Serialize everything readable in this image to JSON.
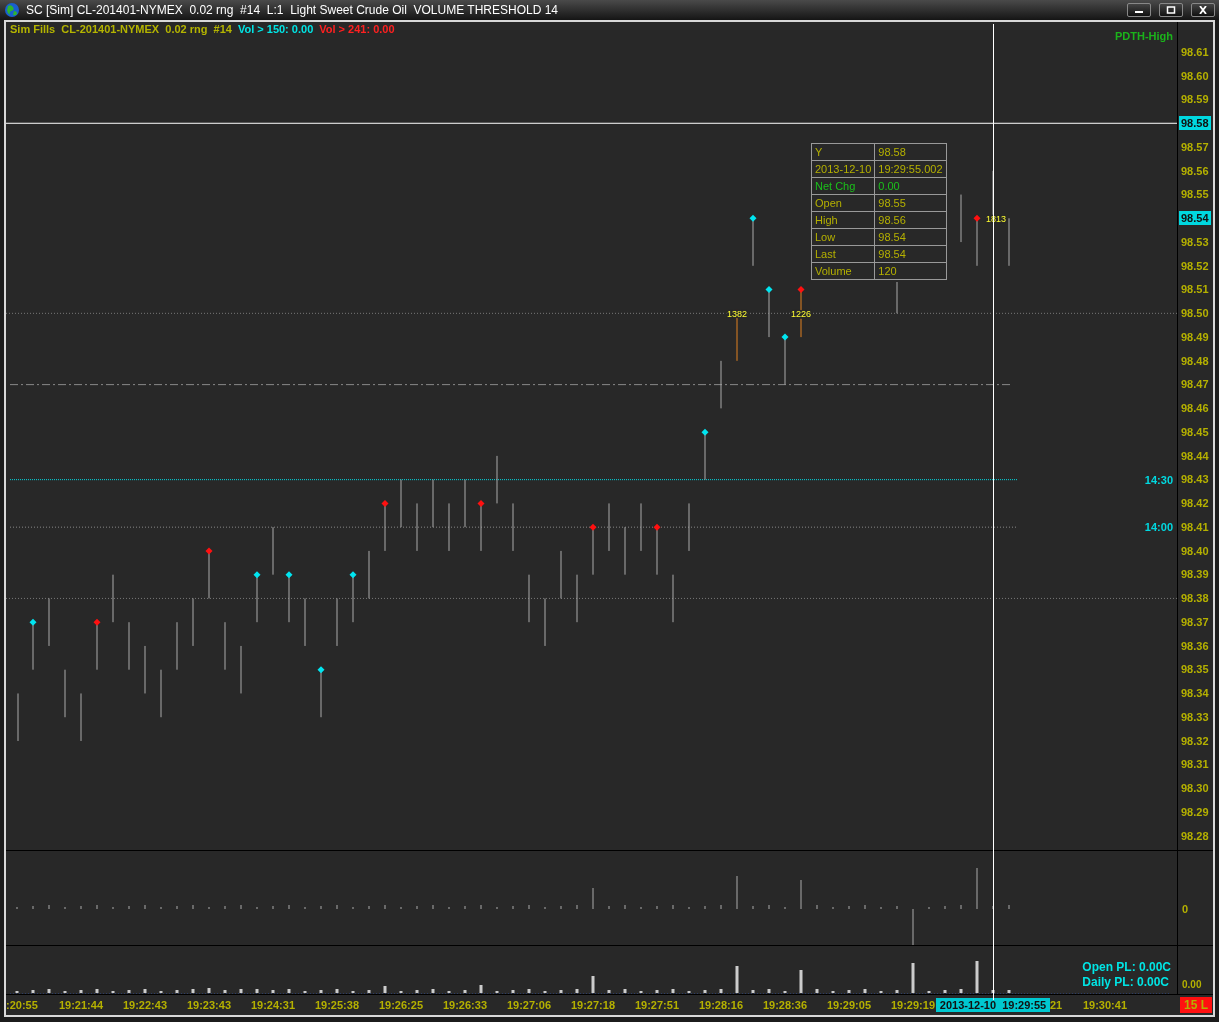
{
  "window": {
    "title": "SC [Sim] CL-201401-NYMEX  0.02 rng  #14  L:1  Light Sweet Crude Oil  VOLUME THRESHOLD 14"
  },
  "chart_header": [
    {
      "text": "Sim Fills  CL-201401-NYMEX  0.02 rng  #14",
      "color": "#b4b400"
    },
    {
      "text": "Vol > 150: 0.00",
      "color": "#00e5e5"
    },
    {
      "text": "Vol > 241: 0.00",
      "color": "#ff2020"
    }
  ],
  "study_label": "PDTH-High",
  "price_axis": [
    {
      "label": "98.61",
      "highlight": false
    },
    {
      "label": "98.60",
      "highlight": false
    },
    {
      "label": "98.59",
      "highlight": false
    },
    {
      "label": "98.58",
      "highlight": true
    },
    {
      "label": "98.57",
      "highlight": false
    },
    {
      "label": "98.56",
      "highlight": false
    },
    {
      "label": "98.55",
      "highlight": false
    },
    {
      "label": "98.54",
      "highlight": true
    },
    {
      "label": "98.53",
      "highlight": false
    },
    {
      "label": "98.52",
      "highlight": false
    },
    {
      "label": "98.51",
      "highlight": false
    },
    {
      "label": "98.50",
      "highlight": false
    },
    {
      "label": "98.49",
      "highlight": false
    },
    {
      "label": "98.48",
      "highlight": false
    },
    {
      "label": "98.47",
      "highlight": false
    },
    {
      "label": "98.46",
      "highlight": false
    },
    {
      "label": "98.45",
      "highlight": false
    },
    {
      "label": "98.44",
      "highlight": false
    },
    {
      "label": "98.43",
      "highlight": false
    },
    {
      "label": "98.42",
      "highlight": false
    },
    {
      "label": "98.41",
      "highlight": false
    },
    {
      "label": "98.40",
      "highlight": false
    },
    {
      "label": "98.39",
      "highlight": false
    },
    {
      "label": "98.38",
      "highlight": false
    },
    {
      "label": "98.37",
      "highlight": false
    },
    {
      "label": "98.36",
      "highlight": false
    },
    {
      "label": "98.35",
      "highlight": false
    },
    {
      "label": "98.34",
      "highlight": false
    },
    {
      "label": "98.33",
      "highlight": false
    },
    {
      "label": "98.32",
      "highlight": false
    },
    {
      "label": "98.31",
      "highlight": false
    },
    {
      "label": "98.30",
      "highlight": false
    },
    {
      "label": "98.29",
      "highlight": false
    },
    {
      "label": "98.28",
      "highlight": false
    }
  ],
  "level_labels": [
    "14:30",
    "14:00"
  ],
  "bar_labels": [
    "1382",
    "1226",
    "1813"
  ],
  "data_window": [
    {
      "label": "Y",
      "value": "98.58",
      "kind": "plain"
    },
    {
      "label": "2013-12-10",
      "value": "19:29:55.002",
      "kind": "plain"
    },
    {
      "label": "Net Chg",
      "value": "0.00",
      "kind": "change"
    },
    {
      "label": "Open",
      "value": "98.55",
      "kind": "plain"
    },
    {
      "label": "High",
      "value": "98.56",
      "kind": "plain"
    },
    {
      "label": "Low",
      "value": "98.54",
      "kind": "plain"
    },
    {
      "label": "Last",
      "value": "98.54",
      "kind": "plain"
    },
    {
      "label": "Volume",
      "value": "120",
      "kind": "plain"
    }
  ],
  "lower_panel_axis": "0",
  "pl": {
    "open": "Open PL: 0.00C",
    "daily": "Daily PL: 0.00C"
  },
  "volume_axis": "0.00",
  "time_axis": [
    {
      "text": ":20:55",
      "kind": "cut-start"
    },
    {
      "text": "19:21:44",
      "kind": "full"
    },
    {
      "text": "19:22:43",
      "kind": "full"
    },
    {
      "text": "19:23:43",
      "kind": "full"
    },
    {
      "text": "19:24:31",
      "kind": "full"
    },
    {
      "text": "19:25:38",
      "kind": "full"
    },
    {
      "text": "19:26:25",
      "kind": "full"
    },
    {
      "text": "19:26:33",
      "kind": "full"
    },
    {
      "text": "19:27:06",
      "kind": "full"
    },
    {
      "text": "19:27:18",
      "kind": "full"
    },
    {
      "text": "19:27:51",
      "kind": "full"
    },
    {
      "text": "19:28:16",
      "kind": "full"
    },
    {
      "text": "19:28:36",
      "kind": "full"
    },
    {
      "text": "19:29:05",
      "kind": "full"
    },
    {
      "text": "19:29:19",
      "kind": "full"
    },
    {
      "text": "2013-12-10  19:29:55",
      "kind": "cursor"
    },
    {
      "text": "21",
      "kind": "cut-end"
    },
    {
      "text": "19:30:41",
      "kind": "full"
    }
  ],
  "status_badge": "15 L"
}
